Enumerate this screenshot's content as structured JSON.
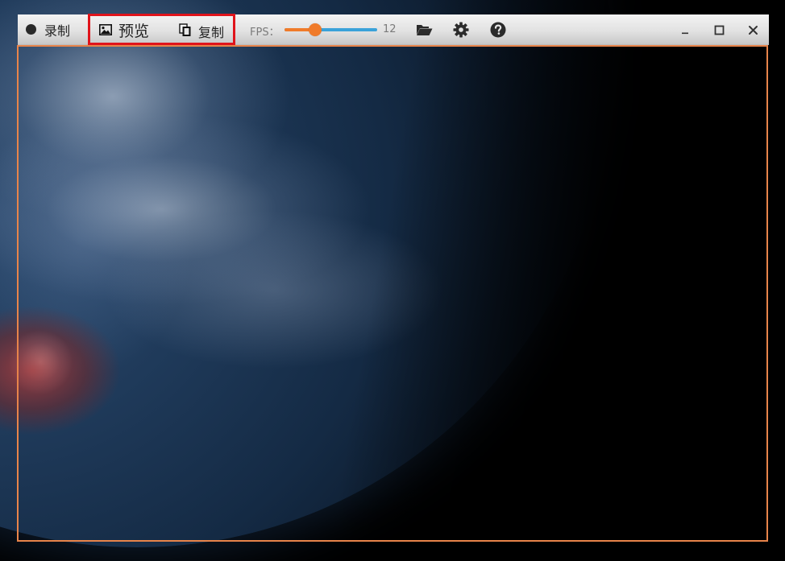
{
  "toolbar": {
    "record_label": "录制",
    "preview_label": "预览",
    "copy_label": "复制",
    "fps_label": "FPS：",
    "fps_value": "12",
    "fps_slider_fraction": 0.33,
    "icons": {
      "record": "record-dot-icon",
      "preview": "image-icon",
      "copy": "copy-icon",
      "folder": "folder-open-icon",
      "settings": "gear-icon",
      "help": "question-circle-icon",
      "minimize": "minimize-icon",
      "maximize": "maximize-icon",
      "close": "close-icon"
    }
  },
  "colors": {
    "highlight": "#e0141b",
    "frame_border": "#e8844a",
    "slider_fill": "#f07b2a",
    "slider_track": "#3aa2d9"
  }
}
